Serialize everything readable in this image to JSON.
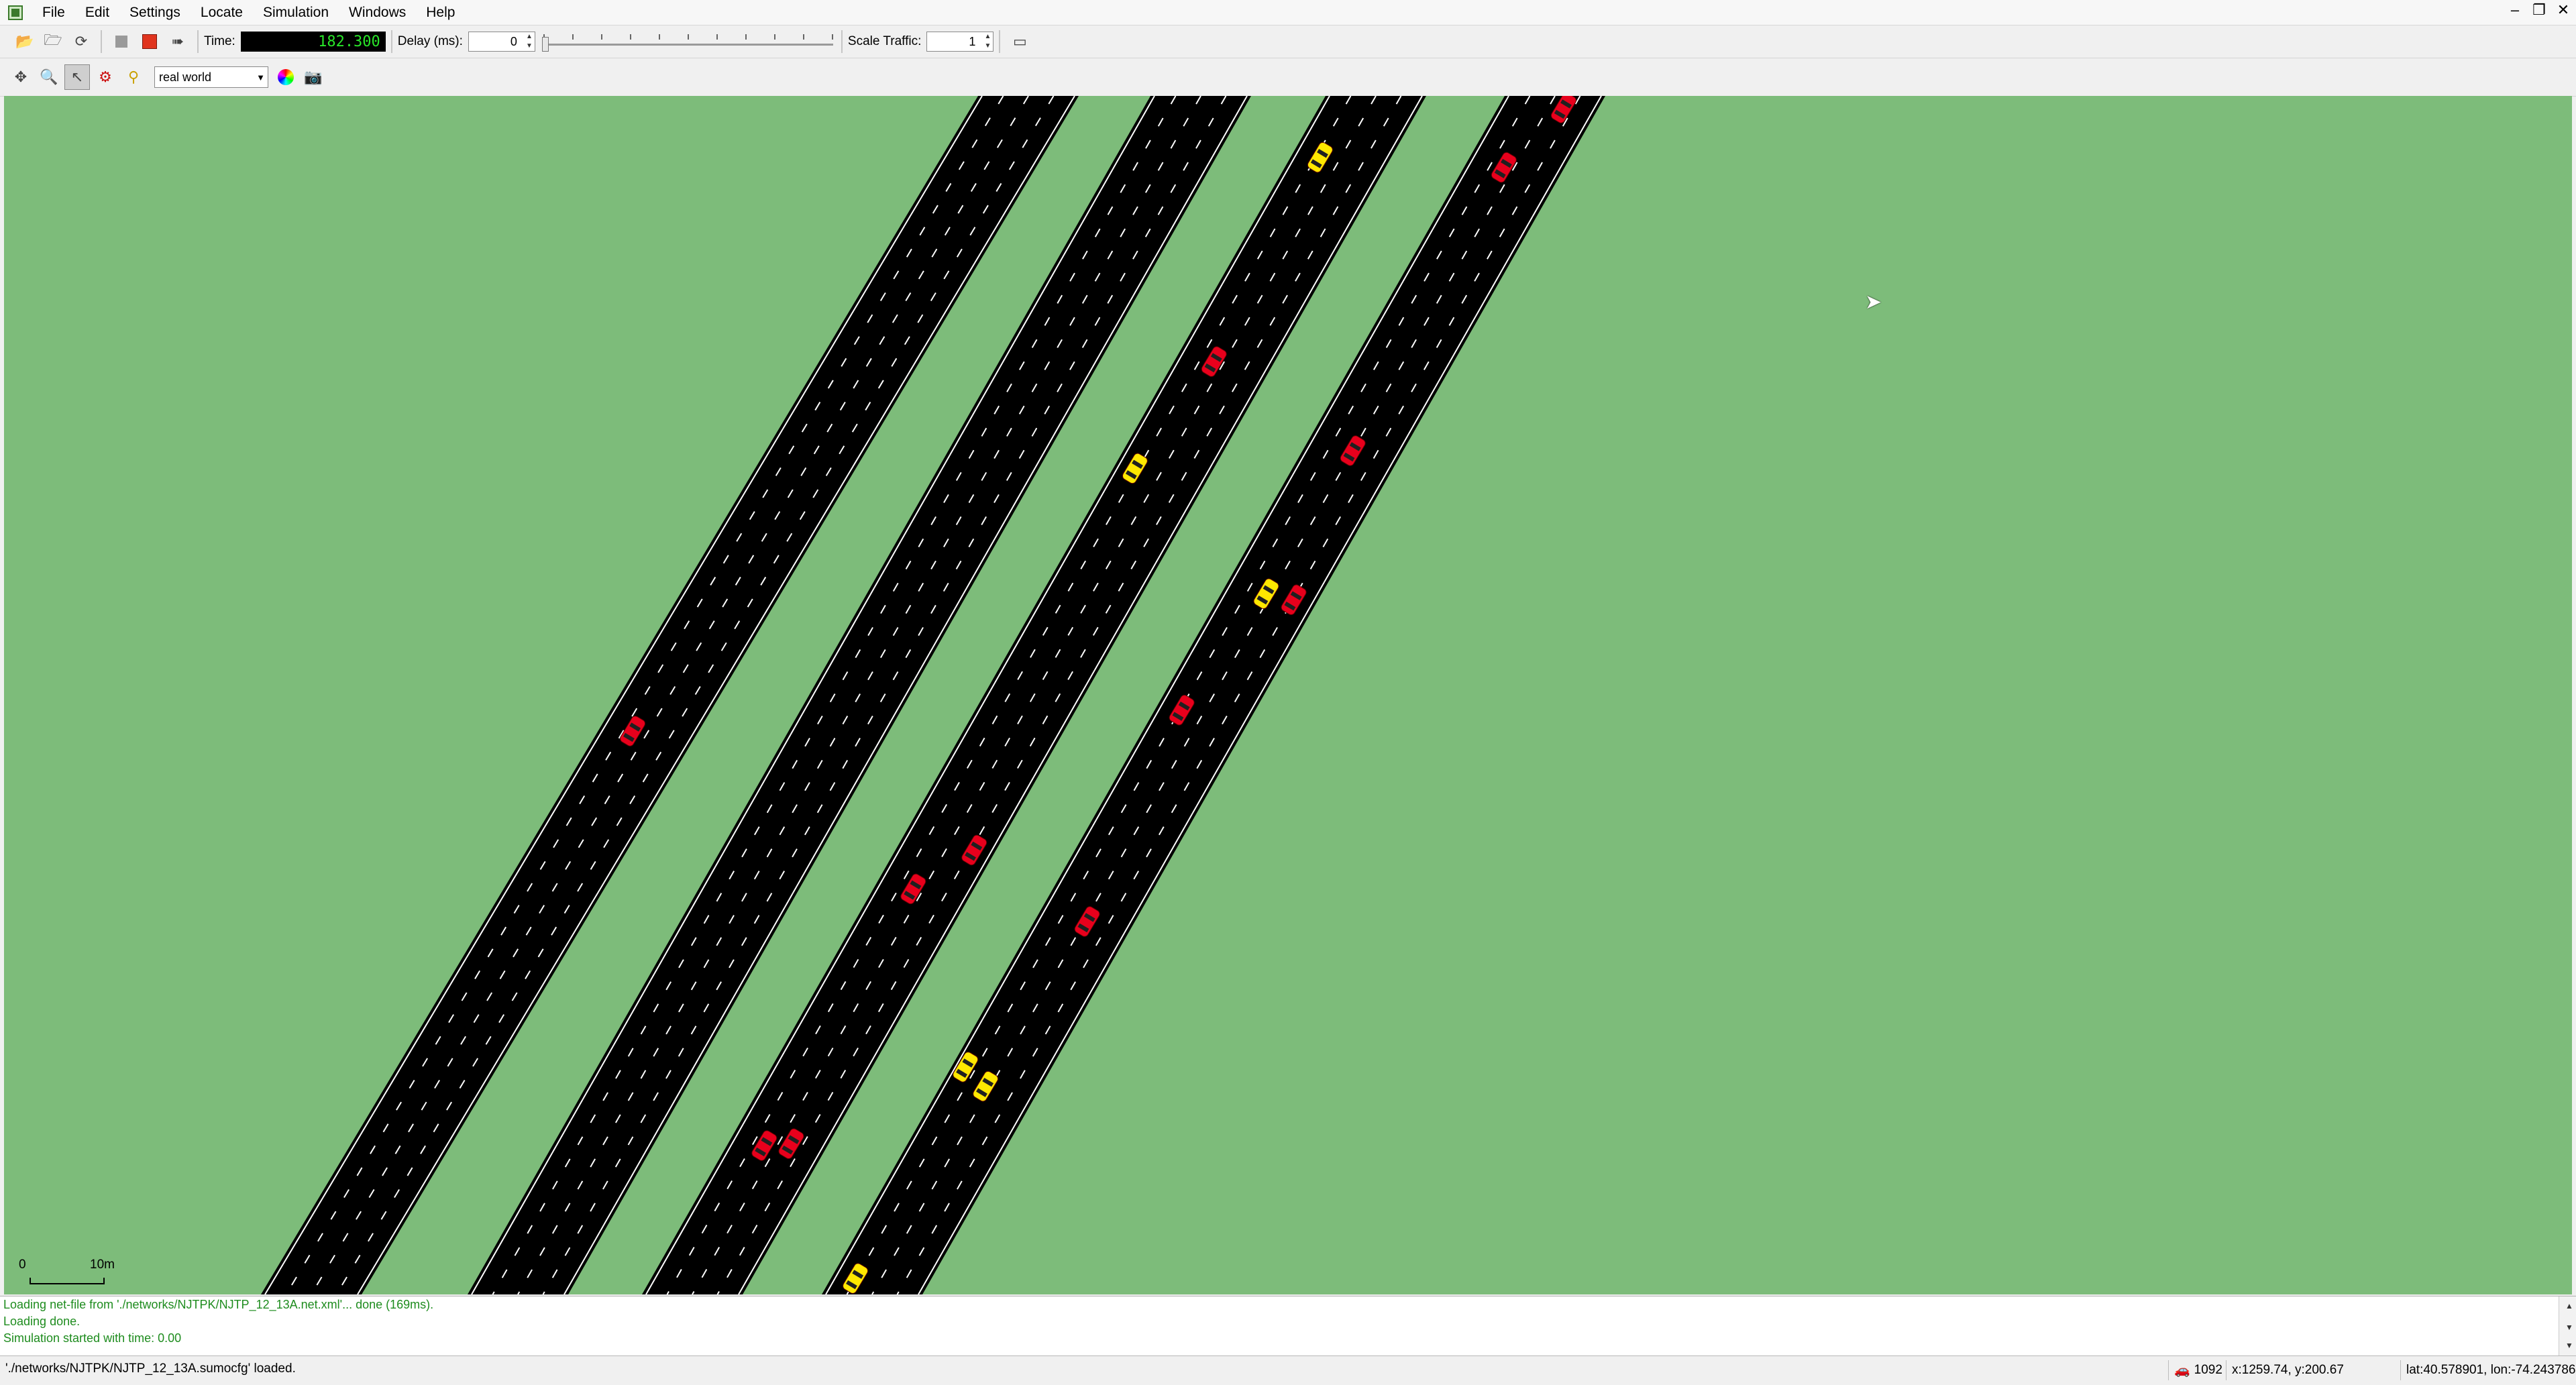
{
  "menu": {
    "items": [
      "File",
      "Edit",
      "Settings",
      "Locate",
      "Simulation",
      "Windows",
      "Help"
    ]
  },
  "toolbar": {
    "time_label": "Time:",
    "time_value": "182.300",
    "delay_label": "Delay (ms):",
    "delay_value": "0",
    "scale_label": "Scale Traffic:",
    "scale_value": "1"
  },
  "view_toolbar": {
    "scheme": "real world"
  },
  "scale_bar": {
    "start": "0",
    "end": "10m"
  },
  "messages": [
    "Loading net-file from './networks/NJTPK/NJTP_12_13A.net.xml'... done (169ms).",
    "Loading done.",
    "Simulation started with time: 0.00"
  ],
  "status": {
    "file": "'./networks/NJTPK/NJTP_12_13A.sumocfg' loaded.",
    "vehicle_count": "1092",
    "coords": "x:1259.74, y:200.67",
    "geo": "lat:40.578901, lon:-74.243786"
  },
  "colors": {
    "grass": "#7dbc7a",
    "road": "#000000",
    "car_red": "#e8001c",
    "car_yellow": "#ffe800"
  }
}
